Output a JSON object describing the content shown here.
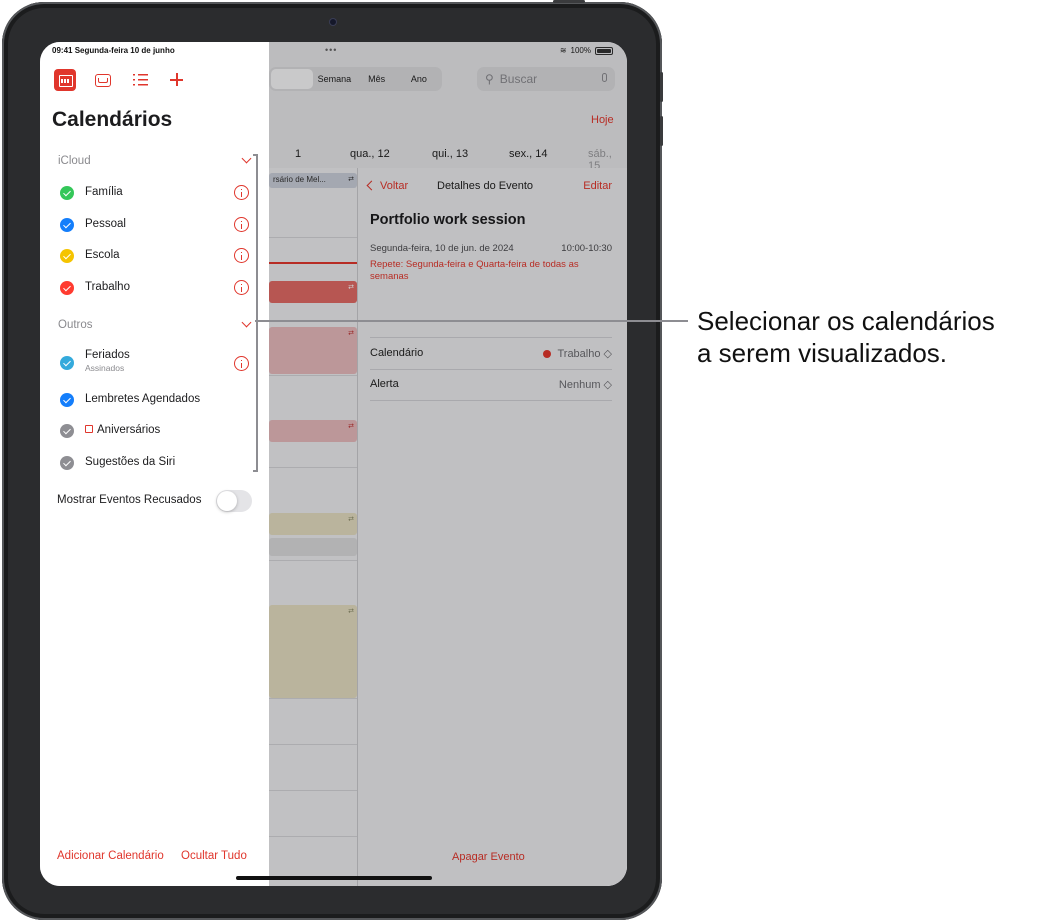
{
  "status": {
    "time": "09:41",
    "date": "Segunda-feira 10 de junho",
    "battery": "100%",
    "dots": "•••"
  },
  "toolbar": {
    "views": [
      "",
      "Semana",
      "Mês",
      "Ano"
    ],
    "search_placeholder": "Buscar",
    "today": "Hoje"
  },
  "week": {
    "days": [
      "1",
      "qua., 12",
      "qui., 13",
      "sex., 14",
      "sáb., 15"
    ],
    "event_label": "rsário de Mel..."
  },
  "detail": {
    "back": "Voltar",
    "title": "Detalhes do Evento",
    "edit": "Editar",
    "event_title": "Portfolio work session",
    "date": "Segunda-feira, 10 de jun. de 2024",
    "time": "10:00-10:30",
    "repeat": "Repete: Segunda-feira e Quarta-feira de todas as semanas",
    "calendar_label": "Calendário",
    "calendar_value": "Trabalho ◇",
    "alert_label": "Alerta",
    "alert_value": "Nenhum ◇",
    "delete": "Apagar Evento"
  },
  "sidebar": {
    "title": "Calendários",
    "icloud_label": "iCloud",
    "icloud_items": [
      {
        "label": "Família",
        "color": "#34c759"
      },
      {
        "label": "Pessoal",
        "color": "#147efb"
      },
      {
        "label": "Escola",
        "color": "#ffcc00"
      },
      {
        "label": "Trabalho",
        "color": "#ff3b30"
      }
    ],
    "outros_label": "Outros",
    "outros_items": [
      {
        "label": "Feriados",
        "sublabel": "Assinados",
        "color": "#34aadc"
      },
      {
        "label": "Lembretes Agendados",
        "color": "#147efb"
      },
      {
        "label": "Aniversários",
        "color": "#8e8e93"
      },
      {
        "label": "Sugestões da Siri",
        "color": "#8e8e93"
      }
    ],
    "show_declined": "Mostrar Eventos Recusados",
    "add_calendar": "Adicionar Calendário",
    "hide_all": "Ocultar Tudo"
  },
  "callout": {
    "line1": "Selecionar os calendários",
    "line2": "a serem visualizados."
  },
  "colors": {
    "accent": "#e0362c"
  }
}
